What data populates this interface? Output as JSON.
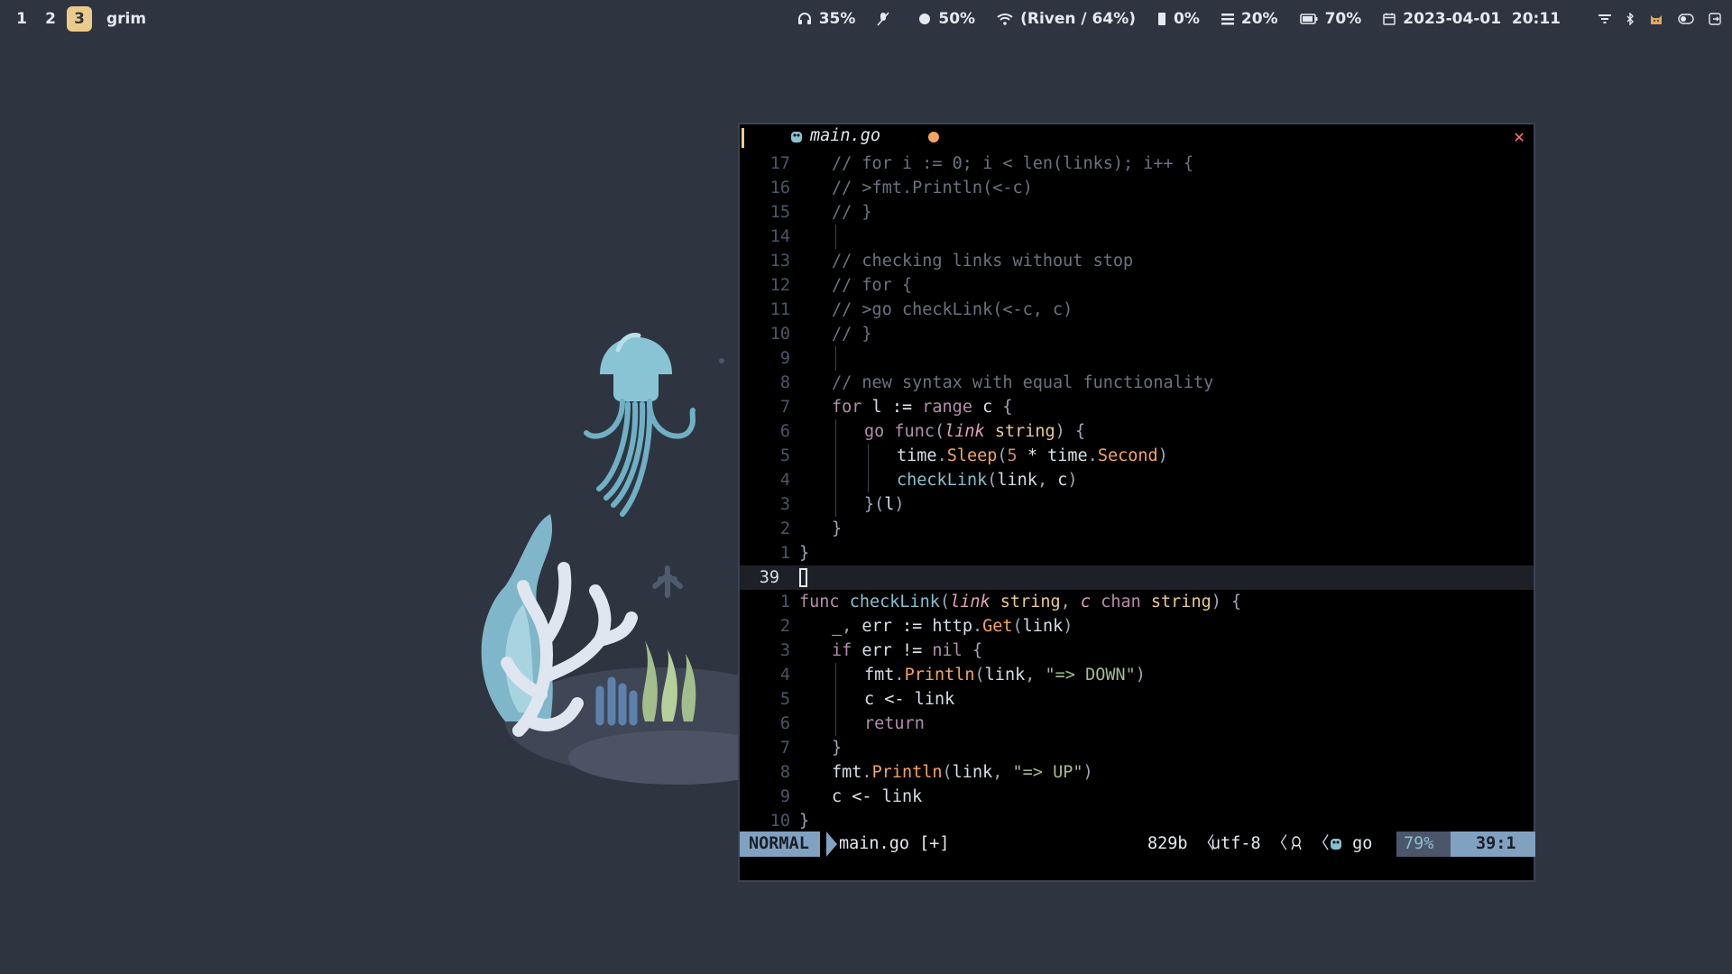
{
  "topbar": {
    "workspaces": [
      "1",
      "2",
      "3"
    ],
    "active_workspace": "3",
    "window_title": "grim",
    "status": {
      "volume": "35%",
      "brightness": "50%",
      "wifi": "(Riven / 64%)",
      "disk": "0%",
      "memory": "20%",
      "battery": "70%",
      "datetime": "2023-04-01  20:11"
    },
    "icons": [
      "headphones-icon",
      "mic-muted-icon",
      "brightness-icon",
      "wifi-icon",
      "disk-icon",
      "memory-icon",
      "battery-icon",
      "calendar-icon",
      "network-icon",
      "bluetooth-icon",
      "cat-icon",
      "toggle-icon",
      "exit-icon"
    ]
  },
  "editor": {
    "tab": {
      "filename": "main.go",
      "modified": true,
      "close": "✕"
    },
    "lines": [
      {
        "n": "17",
        "indent": 1,
        "text": "// for i := 0; i < len(links); i++ {"
      },
      {
        "n": "16",
        "indent": 1,
        "text": "// >fmt.Println(<-c)"
      },
      {
        "n": "15",
        "indent": 1,
        "text": "// }"
      },
      {
        "n": "14",
        "indent": 1,
        "text": ""
      },
      {
        "n": "13",
        "indent": 1,
        "text": "// checking links without stop"
      },
      {
        "n": "12",
        "indent": 1,
        "text": "// for {"
      },
      {
        "n": "11",
        "indent": 1,
        "text": "// >go checkLink(<-c, c)"
      },
      {
        "n": "10",
        "indent": 1,
        "text": "// }"
      },
      {
        "n": "9",
        "indent": 1,
        "text": ""
      },
      {
        "n": "8",
        "indent": 1,
        "text": "// new syntax with equal functionality"
      },
      {
        "n": "7",
        "indent": 1,
        "text": "for l := range c {"
      },
      {
        "n": "6",
        "indent": 2,
        "text": "go func(link string) {"
      },
      {
        "n": "5",
        "indent": 3,
        "text": "time.Sleep(5 * time.Second)"
      },
      {
        "n": "4",
        "indent": 3,
        "text": "checkLink(link, c)"
      },
      {
        "n": "3",
        "indent": 2,
        "text": "}(l)"
      },
      {
        "n": "2",
        "indent": 1,
        "text": "}"
      },
      {
        "n": "1",
        "indent": 0,
        "text": "}"
      },
      {
        "n": "39",
        "indent": 0,
        "text": "",
        "current": true
      },
      {
        "n": "1",
        "indent": 0,
        "text": "func checkLink(link string, c chan string) {"
      },
      {
        "n": "2",
        "indent": 1,
        "text": "_, err := http.Get(link)"
      },
      {
        "n": "3",
        "indent": 1,
        "text": "if err != nil {"
      },
      {
        "n": "4",
        "indent": 2,
        "text": "fmt.Println(link, \"=> DOWN\")"
      },
      {
        "n": "5",
        "indent": 2,
        "text": "c <- link"
      },
      {
        "n": "6",
        "indent": 2,
        "text": "return"
      },
      {
        "n": "7",
        "indent": 1,
        "text": "}"
      },
      {
        "n": "8",
        "indent": 1,
        "text": "fmt.Println(link, \"=> UP\")"
      },
      {
        "n": "9",
        "indent": 1,
        "text": "c <- link"
      },
      {
        "n": "10",
        "indent": 0,
        "text": "}"
      }
    ]
  },
  "statusline": {
    "mode": "NORMAL",
    "file": "main.go [+]",
    "size": "829b",
    "encoding": "utf-8",
    "filetype": "go",
    "percent": "79%",
    "position": "39:1"
  },
  "colors": {
    "background": "#2e3440",
    "active_workspace": "#ebcb8b",
    "mode_bg": "#81a1c1",
    "close": "#ff6f7f",
    "modified_dot": "#f4a460"
  }
}
